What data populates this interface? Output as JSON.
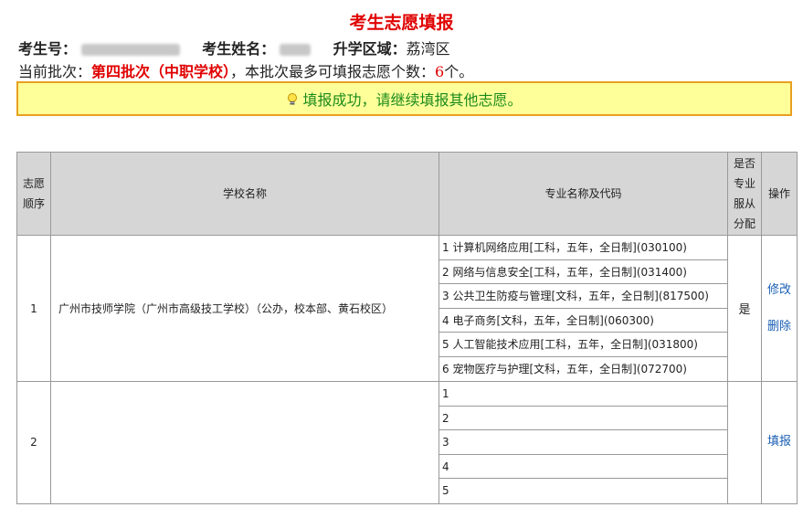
{
  "title": "考生志愿填报",
  "info": {
    "exam_no_label": "考生号：",
    "name_label": "考生姓名：",
    "district_label": "升学区域：",
    "district_value": "荔湾区"
  },
  "batch": {
    "prefix": "当前批次：",
    "name": "第四批次（中职学校）",
    "middle": "，本批次最多可填报志愿个数：",
    "count": "6",
    "suffix": "个。"
  },
  "notice": {
    "icon": "lightbulb-icon",
    "text": "填报成功，请继续填报其他志愿。"
  },
  "table": {
    "headers": {
      "order": "志愿顺序",
      "school": "学校名称",
      "major": "专业名称及代码",
      "assign": "是否专业服从分配",
      "op": "操作"
    },
    "rows": [
      {
        "order": "1",
        "school": "广州市技师学院（广州市高级技工学校）（公办，校本部、黄石校区）",
        "majors": [
          "1 计算机网络应用[工科，五年，全日制](030100)",
          "2 网络与信息安全[工科，五年，全日制](031400)",
          "3 公共卫生防疫与管理[文科，五年，全日制](817500)",
          "4 电子商务[文科，五年，全日制](060300)",
          "5 人工智能技术应用[工科，五年，全日制](031800)",
          "6 宠物医疗与护理[文科，五年，全日制](072700)"
        ],
        "assign": "是",
        "actions": [
          "修改",
          "删除"
        ]
      },
      {
        "order": "2",
        "school": "",
        "majors": [
          "1",
          "2",
          "3",
          "4",
          "5"
        ],
        "assign": "",
        "actions": [
          "填报"
        ]
      }
    ]
  },
  "colors": {
    "title_red": "#e00000",
    "notice_bg": "#ffff99",
    "notice_border": "#e8a020",
    "notice_text": "#1a8a1a",
    "link": "#1a5fb4",
    "header_bg": "#d6d6d6"
  }
}
